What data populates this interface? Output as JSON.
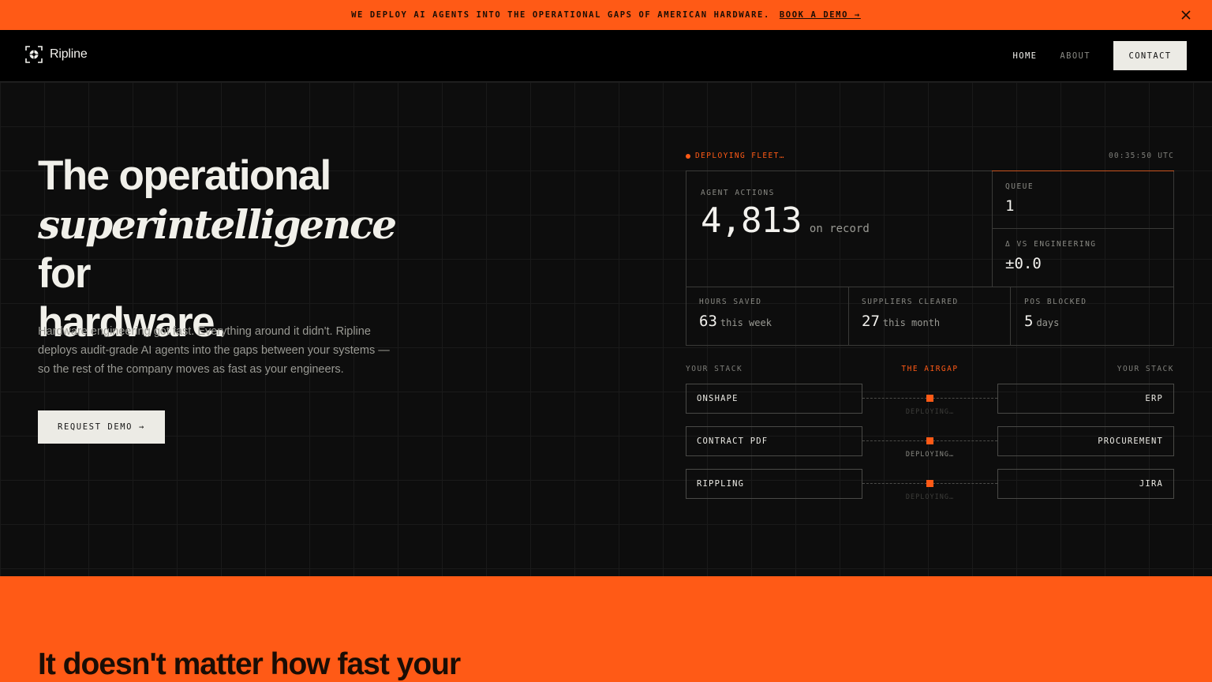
{
  "announcement": {
    "text": "WE DEPLOY AI AGENTS INTO THE OPERATIONAL GAPS OF AMERICAN HARDWARE.",
    "link": "BOOK A DEMO →"
  },
  "nav": {
    "brand": "Ripline",
    "links": [
      "HOME",
      "ABOUT"
    ],
    "contact": "CONTACT"
  },
  "hero": {
    "title_line1": "The operational",
    "title_italic": "superintelligence",
    "title_for": "for",
    "title_line3": "hardware.",
    "description": "Hardware engineering got fast. Everything around it didn't. Ripline deploys audit-grade AI agents into the gaps between your systems — so the rest of the company moves as fast as your engineers.",
    "cta": "REQUEST DEMO →"
  },
  "dashboard": {
    "status": "DEPLOYING FLEET…",
    "time": "00:35:50 UTC",
    "agent_actions": {
      "label": "AGENT ACTIONS",
      "value": "4,813",
      "unit": "on record"
    },
    "queue": {
      "label": "QUEUE",
      "value": "1"
    },
    "delta": {
      "label": "Δ VS ENGINEERING",
      "value": "±0.0"
    },
    "hours_saved": {
      "label": "HOURS SAVED",
      "value": "63",
      "unit": "this week"
    },
    "suppliers": {
      "label": "SUPPLIERS CLEARED",
      "value": "27",
      "unit": "this month"
    },
    "pos_blocked": {
      "label": "POS BLOCKED",
      "value": "5",
      "unit": "days"
    },
    "stack_left_label": "YOUR STACK",
    "airgap_label": "THE AIRGAP",
    "stack_right_label": "YOUR STACK",
    "rows": [
      {
        "left": "ONSHAPE",
        "right": "ERP",
        "status": "DEPLOYING…"
      },
      {
        "left": "CONTRACT PDF",
        "right": "PROCUREMENT",
        "status": "DEPLOYING…"
      },
      {
        "left": "RIPPLING",
        "right": "JIRA",
        "status": "DEPLOYING…"
      }
    ]
  },
  "section2": {
    "title": "It doesn't matter how fast your"
  },
  "colors": {
    "accent": "#ff5a16",
    "background": "#0d0d0d",
    "light": "#ecebe5"
  }
}
